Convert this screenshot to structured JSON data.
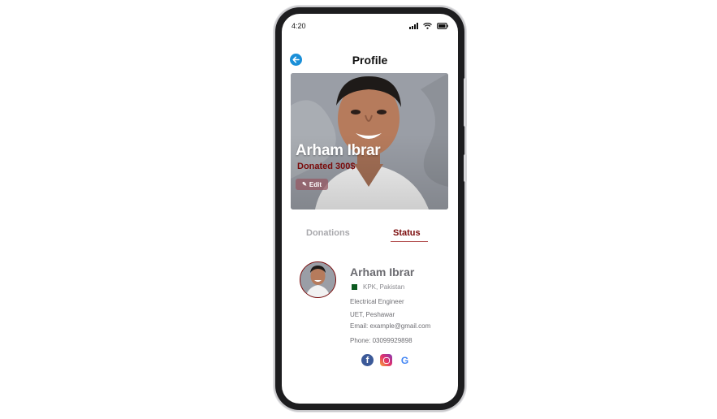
{
  "status_bar": {
    "time": "4:20"
  },
  "header": {
    "title": "Profile"
  },
  "hero": {
    "name": "Arham Ibrar",
    "donated": "Donated 300$",
    "edit_label": "Edit"
  },
  "tabs": [
    {
      "label": "Donations",
      "active": false
    },
    {
      "label": "Status",
      "active": true
    }
  ],
  "profile": {
    "name": "Arham Ibrar",
    "location": "KPK, Pakistan",
    "occupation": "Electrical Engineer",
    "institution": "UET, Peshawar",
    "email": "Email: example@gmail.com",
    "phone": "Phone: 03099929898"
  },
  "socials": [
    {
      "icon": "facebook-icon"
    },
    {
      "icon": "instagram-icon"
    },
    {
      "icon": "google-icon"
    }
  ],
  "colors": {
    "accent": "#7a0a0a",
    "back_button": "#1a8fd8",
    "muted_tab": "#a9a9ad"
  }
}
